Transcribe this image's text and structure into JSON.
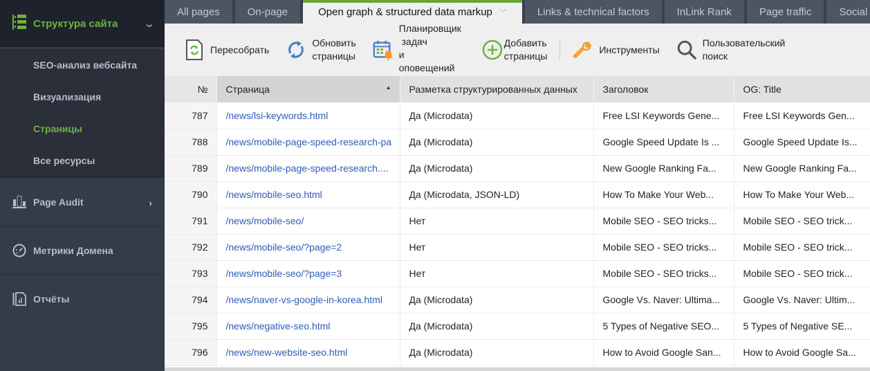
{
  "sidebar": {
    "section": {
      "label": "Структура сайта",
      "icon": "site-structure-icon"
    },
    "sub_items": [
      {
        "label": "SEO-анализ вебсайта",
        "active": false
      },
      {
        "label": "Визуализация",
        "active": false
      },
      {
        "label": "Страницы",
        "active": true
      },
      {
        "label": "Все ресурсы",
        "active": false
      }
    ],
    "items": [
      {
        "label": "Page Audit",
        "icon": "page-audit-icon",
        "has_arrow": true
      },
      {
        "label": "Метрики Домена",
        "icon": "gauge-icon",
        "has_arrow": false
      },
      {
        "label": "Отчёты",
        "icon": "report-icon",
        "has_arrow": false
      }
    ]
  },
  "tabs": [
    {
      "label": "All pages",
      "active": false
    },
    {
      "label": "On-page",
      "active": false
    },
    {
      "label": "Open graph & structured data markup",
      "active": true
    },
    {
      "label": "Links & technical factors",
      "active": false
    },
    {
      "label": "InLink Rank",
      "active": false
    },
    {
      "label": "Page traffic",
      "active": false
    },
    {
      "label": "Social Media",
      "active": false
    }
  ],
  "toolbar": {
    "rebuild": "Пересобрать",
    "update_line1": "Обновить",
    "update_line2": "страницы",
    "scheduler_line1": "Планировщик",
    "scheduler_line2": " задач",
    "scheduler_line3": "и",
    "scheduler_line4": "оповещений",
    "add_line1": "Добавить",
    "add_line2": "страницы",
    "tools": "Инструменты",
    "search_line1": "Пользовательский",
    "search_line2": "поиск"
  },
  "table": {
    "columns": [
      "№",
      "Страница",
      "Разметка структурированных данных",
      "Заголовок",
      "OG: Title"
    ],
    "sorted_column": "Страница",
    "sort_direction": "ascending",
    "rows": [
      {
        "num": "787",
        "page": "/news/lsi-keywords.html",
        "markup": "Да (Microdata)",
        "title": "Free LSI Keywords Gene...",
        "og_title": "Free LSI Keywords Gen..."
      },
      {
        "num": "788",
        "page": "/news/mobile-page-speed-research-pa",
        "markup": "Да (Microdata)",
        "title": "Google Speed Update Is ...",
        "og_title": "Google Speed Update Is..."
      },
      {
        "num": "789",
        "page": "/news/mobile-page-speed-research....",
        "markup": "Да (Microdata)",
        "title": "New Google Ranking Fa...",
        "og_title": "New Google Ranking Fa..."
      },
      {
        "num": "790",
        "page": "/news/mobile-seo.html",
        "markup": "Да (Microdata, JSON-LD)",
        "title": "How To Make Your Web...",
        "og_title": "How To Make Your Web..."
      },
      {
        "num": "791",
        "page": "/news/mobile-seo/",
        "markup": "Нет",
        "title": "Mobile SEO - SEO tricks...",
        "og_title": "Mobile SEO - SEO trick..."
      },
      {
        "num": "792",
        "page": "/news/mobile-seo/?page=2",
        "markup": "Нет",
        "title": "Mobile SEO - SEO tricks...",
        "og_title": "Mobile SEO - SEO trick..."
      },
      {
        "num": "793",
        "page": "/news/mobile-seo/?page=3",
        "markup": "Нет",
        "title": "Mobile SEO - SEO tricks...",
        "og_title": "Mobile SEO - SEO trick..."
      },
      {
        "num": "794",
        "page": "/news/naver-vs-google-in-korea.html",
        "markup": "Да (Microdata)",
        "title": "Google Vs. Naver: Ultima...",
        "og_title": "Google Vs. Naver: Ultim..."
      },
      {
        "num": "795",
        "page": "/news/negative-seo.html",
        "markup": "Да (Microdata)",
        "title": "5 Types of Negative SEO...",
        "og_title": "5 Types of Negative SE..."
      },
      {
        "num": "796",
        "page": "/news/new-website-seo.html",
        "markup": "Да (Microdata)",
        "title": "How to Avoid Google San...",
        "og_title": "How to Avoid Google Sa..."
      }
    ]
  },
  "colors": {
    "accent_green": "#6db33f",
    "sidebar_bg": "#353b47",
    "link_blue": "#2f5bb7",
    "tools_orange": "#f59a23"
  }
}
